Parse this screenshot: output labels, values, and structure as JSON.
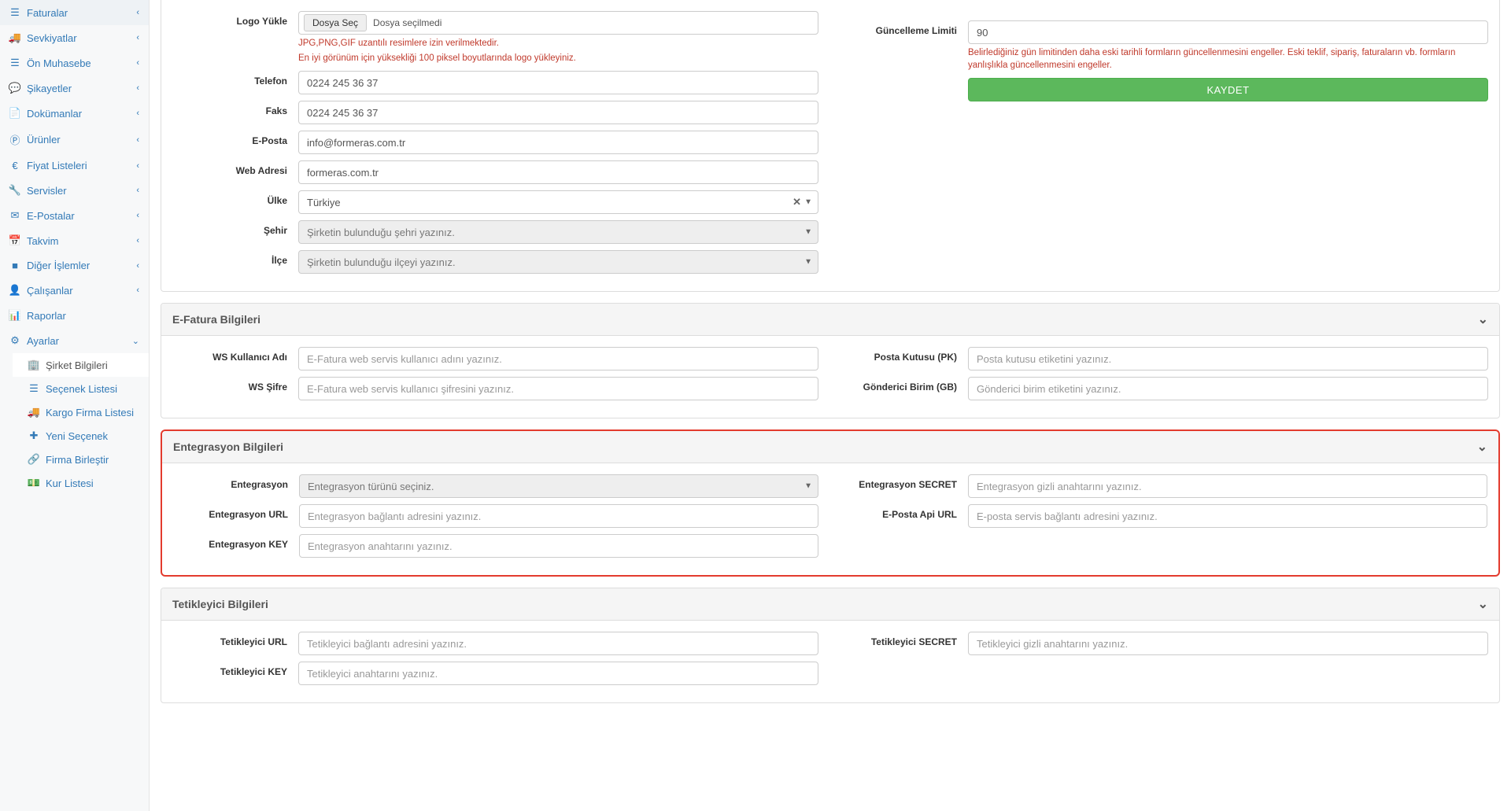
{
  "sidebar": {
    "items": [
      {
        "icon": "list",
        "label": "Faturalar"
      },
      {
        "icon": "truck",
        "label": "Sevkiyatlar"
      },
      {
        "icon": "list",
        "label": "Ön Muhasebe"
      },
      {
        "icon": "comment",
        "label": "Şikayetler"
      },
      {
        "icon": "file",
        "label": "Dokümanlar"
      },
      {
        "icon": "product",
        "label": "Ürünler"
      },
      {
        "icon": "euro",
        "label": "Fiyat Listeleri"
      },
      {
        "icon": "wrench",
        "label": "Servisler"
      },
      {
        "icon": "envelope",
        "label": "E-Postalar"
      },
      {
        "icon": "calendar",
        "label": "Takvim"
      },
      {
        "icon": "square",
        "label": "Diğer İşlemler"
      },
      {
        "icon": "user",
        "label": "Çalışanlar"
      },
      {
        "icon": "chart",
        "label": "Raporlar"
      },
      {
        "icon": "gear",
        "label": "Ayarlar"
      }
    ],
    "sub": [
      {
        "icon": "building",
        "label": "Şirket Bilgileri"
      },
      {
        "icon": "list2",
        "label": "Seçenek Listesi"
      },
      {
        "icon": "truck2",
        "label": "Kargo Firma Listesi"
      },
      {
        "icon": "plus",
        "label": "Yeni Seçenek"
      },
      {
        "icon": "link",
        "label": "Firma Birleştir"
      },
      {
        "icon": "money",
        "label": "Kur Listesi"
      }
    ]
  },
  "form": {
    "logo_label": "Logo Yükle",
    "file_button": "Dosya Seç",
    "file_text": "Dosya seçilmedi",
    "logo_help1": "JPG,PNG,GIF uzantılı resimlere izin verilmektedir.",
    "logo_help2": "En iyi görünüm için yüksekliği 100 piksel boyutlarında logo yükleyiniz.",
    "telefon_label": "Telefon",
    "telefon_value": "0224 245 36 37",
    "faks_label": "Faks",
    "faks_value": "0224 245 36 37",
    "eposta_label": "E-Posta",
    "eposta_value": "info@formeras.com.tr",
    "web_label": "Web Adresi",
    "web_value": "formeras.com.tr",
    "ulke_label": "Ülke",
    "ulke_value": "Türkiye",
    "sehir_label": "Şehir",
    "sehir_placeholder": "Şirketin bulunduğu şehri yazınız.",
    "ilce_label": "İlçe",
    "ilce_placeholder": "Şirketin bulunduğu ilçeyi yazınız.",
    "limit_label": "Güncelleme Limiti",
    "limit_value": "90",
    "limit_help": "Belirlediğiniz gün limitinden daha eski tarihli formların güncellenmesini engeller. Eski teklif, sipariş, faturaların vb. formların yanlışlıkla güncellenmesini engeller.",
    "save_button": "KAYDET"
  },
  "efatura": {
    "title": "E-Fatura Bilgileri",
    "ws_user_label": "WS Kullanıcı Adı",
    "ws_user_placeholder": "E-Fatura web servis kullanıcı adını yazınız.",
    "ws_pass_label": "WS Şifre",
    "ws_pass_placeholder": "E-Fatura web servis kullanıcı şifresini yazınız.",
    "pk_label": "Posta Kutusu (PK)",
    "pk_placeholder": "Posta kutusu etiketini yazınız.",
    "gb_label": "Gönderici Birim (GB)",
    "gb_placeholder": "Gönderici birim etiketini yazınız."
  },
  "entegrasyon": {
    "title": "Entegrasyon Bilgileri",
    "type_label": "Entegrasyon",
    "type_placeholder": "Entegrasyon türünü seçiniz.",
    "url_label": "Entegrasyon URL",
    "url_placeholder": "Entegrasyon bağlantı adresini yazınız.",
    "key_label": "Entegrasyon KEY",
    "key_placeholder": "Entegrasyon anahtarını yazınız.",
    "secret_label": "Entegrasyon SECRET",
    "secret_placeholder": "Entegrasyon gizli anahtarını yazınız.",
    "api_label": "E-Posta Api URL",
    "api_placeholder": "E-posta servis bağlantı adresini yazınız."
  },
  "tetikleyici": {
    "title": "Tetikleyici Bilgileri",
    "url_label": "Tetikleyici URL",
    "url_placeholder": "Tetikleyici bağlantı adresini yazınız.",
    "key_label": "Tetikleyici KEY",
    "key_placeholder": "Tetikleyici anahtarını yazınız.",
    "secret_label": "Tetikleyici SECRET",
    "secret_placeholder": "Tetikleyici gizli anahtarını yazınız."
  }
}
